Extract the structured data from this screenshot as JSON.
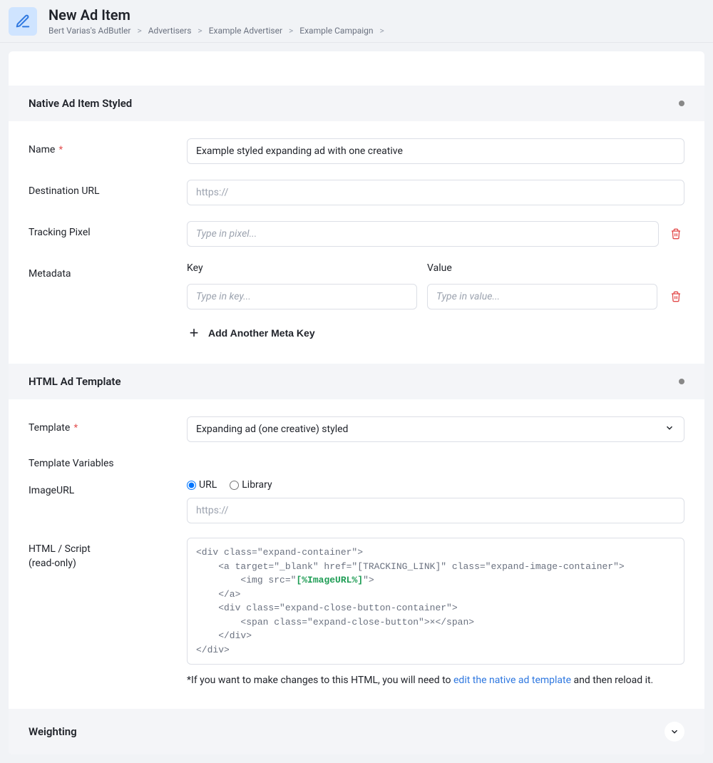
{
  "header": {
    "title": "New Ad Item",
    "breadcrumb": [
      "Bert Varias's AdButler",
      "Advertisers",
      "Example Advertiser",
      "Example Campaign"
    ]
  },
  "sections": {
    "native": {
      "title": "Native Ad Item Styled",
      "fields": {
        "name_label": "Name",
        "name_value": "Example styled expanding ad with one creative",
        "dest_label": "Destination URL",
        "dest_placeholder": "https://",
        "pixel_label": "Tracking Pixel",
        "pixel_placeholder": "Type in pixel...",
        "metadata_label": "Metadata",
        "key_label": "Key",
        "key_placeholder": "Type in key...",
        "value_label": "Value",
        "value_placeholder": "Type in value...",
        "add_meta": "Add Another Meta Key"
      }
    },
    "html_template": {
      "title": "HTML Ad Template",
      "template_label": "Template",
      "template_value": "Expanding ad (one creative) styled",
      "template_vars_label": "Template Variables",
      "imageurl_label": "ImageURL",
      "radio_url": "URL",
      "radio_library": "Library",
      "imageurl_placeholder": "https://",
      "html_label": "HTML / Script",
      "html_readonly": "(read-only)",
      "code_prefix": "<div class=\"expand-container\">\n    <a target=\"_blank\" href=\"[TRACKING_LINK]\" class=\"expand-image-container\">\n        <img src=\"",
      "code_var": "[%ImageURL%]",
      "code_suffix": "\">\n    </a>\n    <div class=\"expand-close-button-container\">\n        <span class=\"expand-close-button\">×</span>\n    </div>\n</div>",
      "note_pre": "*If you want to make changes to this HTML, you will need to ",
      "note_link": "edit the native ad template",
      "note_post": " and then reload it."
    },
    "weighting": {
      "title": "Weighting"
    }
  }
}
